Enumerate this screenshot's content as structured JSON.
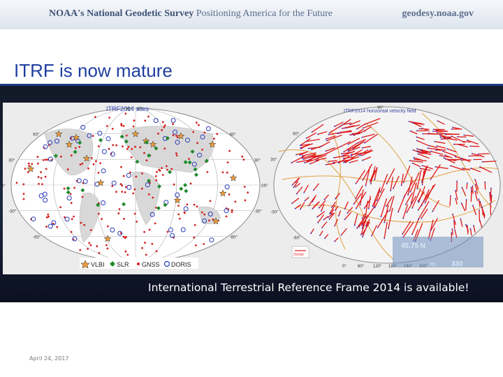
{
  "header": {
    "brand_prefix": "NOAA's",
    "brand_name": "National Geodetic Survey",
    "tagline": "Positioning America for the Future",
    "website": "geodesy.noaa.gov"
  },
  "slide": {
    "title": "ITRF is now mature",
    "caption": "International Terrestrial Reference Frame 2014 is available!",
    "date": "April 24, 2017"
  },
  "left_map": {
    "title": "ITRF2014 sites",
    "lat_labels": [
      "90°",
      "60°",
      "30°",
      "0°",
      "-30°",
      "-60°",
      "-90°"
    ],
    "lat_labels_right": [
      "90°",
      "60°",
      "30°",
      "0°",
      "-30°",
      "-60°",
      "-90°"
    ],
    "legend": {
      "vlbi": "VLBI",
      "slr": "SLR",
      "gnss": "GNSS",
      "doris": "DORIS"
    },
    "colors": {
      "vlbi": "#e89a3c",
      "slr": "#1e8a2e",
      "gnss": "#d42020",
      "doris": "#2a3bb8",
      "map_bg": "#ffffff",
      "grid": "#bdbdbd",
      "land": "#d8d8d8"
    }
  },
  "right_map": {
    "title": "ITRF2014 horizontal velocity field",
    "lat_labels": [
      "90°",
      "60°",
      "30°",
      "0°",
      "-30°",
      "-60°"
    ],
    "lon_labels": [
      "0°",
      "60°",
      "120°",
      "180°",
      "240°",
      "300°"
    ],
    "overlay_coord": "45.75 N",
    "overlay_value": "330",
    "overlay_unit": "m",
    "overlay_scale": "2cm/yr",
    "colors": {
      "vectors": "#e01818",
      "plates": "#e0a040",
      "dots": "#3030c0"
    }
  }
}
